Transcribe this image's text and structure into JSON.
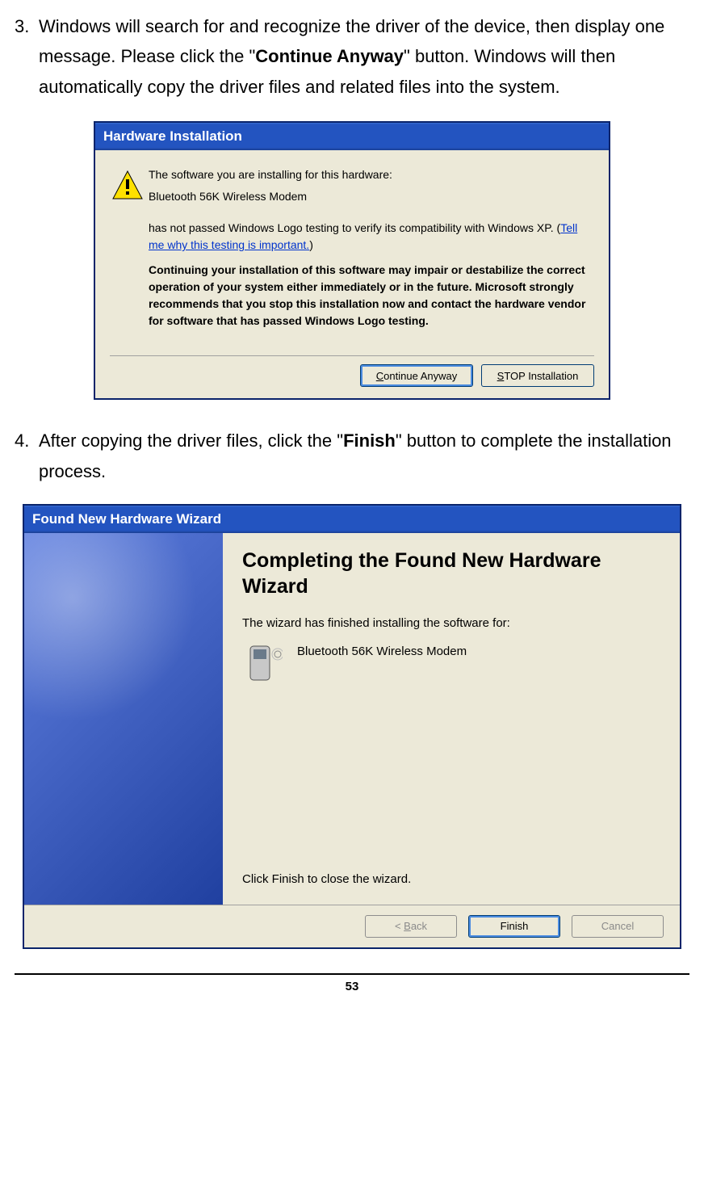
{
  "step3": {
    "num": "3.",
    "text_a": "Windows will search for and recognize the driver of the device, then display one message. Please click the \"",
    "text_bold": "Continue Anyway",
    "text_b": "\" button. Windows will then automatically copy the driver files and related files into the system."
  },
  "dialog1": {
    "title": "Hardware Installation",
    "line1": "The software you are installing for this hardware:",
    "device": "Bluetooth 56K Wireless Modem",
    "line2a": "has not passed Windows Logo testing to verify its compatibility with Windows XP. (",
    "link": "Tell me why this testing is important.",
    "line2b": ")",
    "bold_para": "Continuing your installation of this software may impair or destabilize the correct operation of your system either immediately or in the future. Microsoft strongly recommends that you stop this installation now and contact the hardware vendor for software that has passed Windows Logo testing.",
    "btn_continue_u": "C",
    "btn_continue_rest": "ontinue Anyway",
    "btn_stop_u": "S",
    "btn_stop_rest": "TOP Installation"
  },
  "step4": {
    "num": "4.",
    "text_a": "After copying the driver files, click the \"",
    "text_bold": "Finish",
    "text_b": "\" button to complete the installation process."
  },
  "dialog2": {
    "title": "Found New Hardware Wizard",
    "heading": "Completing the Found New Hardware Wizard",
    "line1": "The wizard has finished installing the software for:",
    "device": "Bluetooth 56K Wireless Modem",
    "close_text": "Click Finish to close the wizard.",
    "btn_back_lt": "< ",
    "btn_back_u": "B",
    "btn_back_rest": "ack",
    "btn_finish": "Finish",
    "btn_cancel": "Cancel"
  },
  "page": "53"
}
